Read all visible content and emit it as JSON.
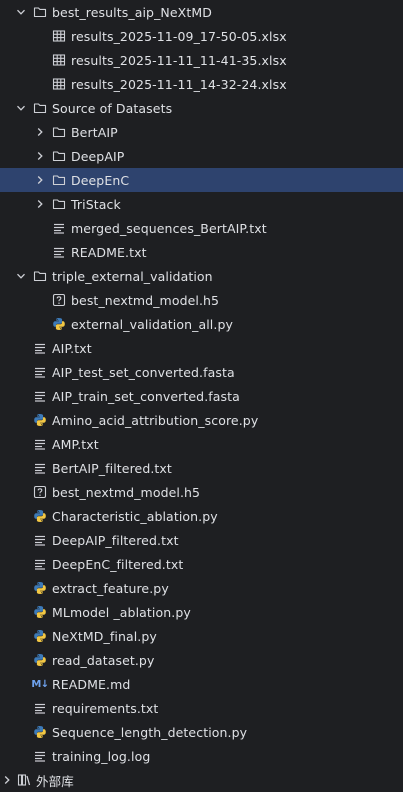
{
  "rows": [
    {
      "id": "best-results-folder",
      "label": "best_results_aip_NeXtMD",
      "icon": "folder",
      "chevron": "down",
      "level": 0
    },
    {
      "id": "xlsx-1",
      "label": "results_2025-11-09_17-50-05.xlsx",
      "icon": "table",
      "level": 1
    },
    {
      "id": "xlsx-2",
      "label": "results_2025-11-11_11-41-35.xlsx",
      "icon": "table",
      "level": 1
    },
    {
      "id": "xlsx-3",
      "label": "results_2025-11-11_14-32-24.xlsx",
      "icon": "table",
      "level": 1
    },
    {
      "id": "source-datasets-folder",
      "label": "Source of Datasets",
      "icon": "folder",
      "chevron": "down",
      "level": 0
    },
    {
      "id": "bertaip-folder",
      "label": "BertAIP",
      "icon": "folder",
      "chevron": "right",
      "level": 1
    },
    {
      "id": "deepaip-folder",
      "label": "DeepAIP",
      "icon": "folder",
      "chevron": "right",
      "level": 1
    },
    {
      "id": "deepenc-folder",
      "label": "DeepEnC",
      "icon": "folder",
      "chevron": "right",
      "level": 1,
      "selected": true
    },
    {
      "id": "tristack-folder",
      "label": "TriStack",
      "icon": "folder",
      "chevron": "right",
      "level": 1
    },
    {
      "id": "merged-sequences-file",
      "label": "merged_sequences_BertAIP.txt",
      "icon": "text",
      "level": 2
    },
    {
      "id": "readme-txt-file",
      "label": "README.txt",
      "icon": "text",
      "level": 2
    },
    {
      "id": "triple-validation-folder",
      "label": "triple_external_validation",
      "icon": "folder",
      "chevron": "down",
      "level": 0
    },
    {
      "id": "h5-model-file-1",
      "label": "best_nextmd_model.h5",
      "icon": "unknown",
      "level": 1
    },
    {
      "id": "external-validation-py",
      "label": "external_validation_all.py",
      "icon": "python",
      "level": 1
    },
    {
      "id": "aip-txt",
      "label": "AIP.txt",
      "icon": "text",
      "level": 3
    },
    {
      "id": "aip-test-fasta",
      "label": "AIP_test_set_converted.fasta",
      "icon": "text",
      "level": 3
    },
    {
      "id": "aip-train-fasta",
      "label": "AIP_train_set_converted.fasta",
      "icon": "text",
      "level": 3
    },
    {
      "id": "amino-acid-py",
      "label": "Amino_acid_attribution_score.py",
      "icon": "python",
      "level": 3
    },
    {
      "id": "amp-txt",
      "label": "AMP.txt",
      "icon": "text",
      "level": 3
    },
    {
      "id": "bertaip-filtered",
      "label": "BertAIP_filtered.txt",
      "icon": "text",
      "level": 3
    },
    {
      "id": "h5-model-file-2",
      "label": "best_nextmd_model.h5",
      "icon": "unknown",
      "level": 3
    },
    {
      "id": "characteristic-py",
      "label": "Characteristic_ablation.py",
      "icon": "python",
      "level": 3
    },
    {
      "id": "deepaip-filtered",
      "label": "DeepAIP_filtered.txt",
      "icon": "text",
      "level": 3
    },
    {
      "id": "deepenc-filtered",
      "label": "DeepEnC_filtered.txt",
      "icon": "text",
      "level": 3
    },
    {
      "id": "extract-feature-py",
      "label": "extract_feature.py",
      "icon": "python",
      "level": 3
    },
    {
      "id": "mlmodel-py",
      "label": "MLmodel _ablation.py",
      "icon": "python",
      "level": 3
    },
    {
      "id": "nextmd-final-py",
      "label": "NeXtMD_final.py",
      "icon": "python",
      "level": 3
    },
    {
      "id": "read-dataset-py",
      "label": "read_dataset.py",
      "icon": "python",
      "level": 3
    },
    {
      "id": "readme-md",
      "label": "README.md",
      "icon": "markdown",
      "level": 3
    },
    {
      "id": "requirements-txt",
      "label": "requirements.txt",
      "icon": "text",
      "level": 3
    },
    {
      "id": "seq-length-py",
      "label": "Sequence_length_detection.py",
      "icon": "python",
      "level": 3
    },
    {
      "id": "training-log",
      "label": "training_log.log",
      "icon": "text",
      "level": 3
    },
    {
      "id": "external-libs",
      "label": "外部库",
      "icon": "library",
      "chevron": "right",
      "level": 4
    }
  ],
  "colors": {
    "background": "#1e1f22",
    "selection": "#2e436e",
    "text": "#dfe1e5",
    "icon": "#ced0d6",
    "python_blue": "#3d7ab8",
    "python_yellow": "#f2c744"
  }
}
